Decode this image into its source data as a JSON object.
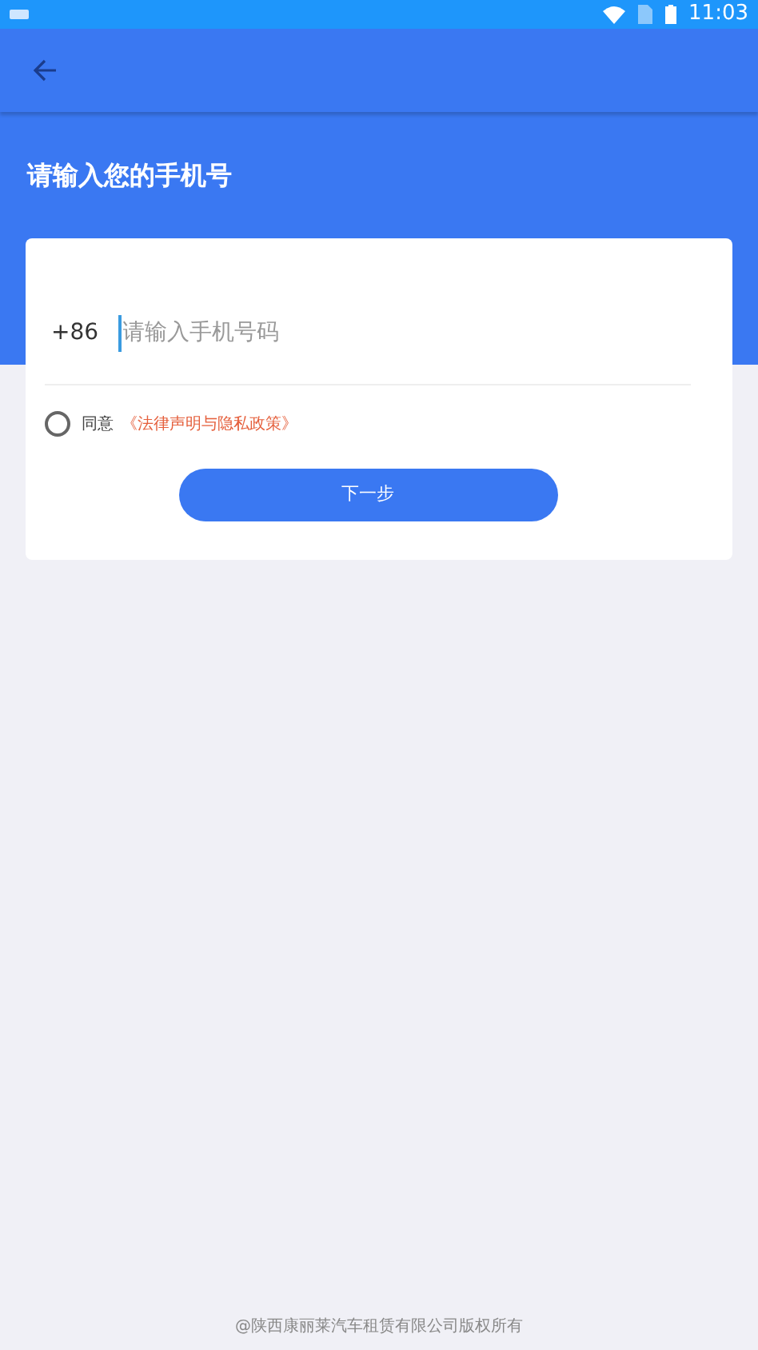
{
  "status_bar": {
    "time": "11:03"
  },
  "heading": "请输入您的手机号",
  "phone": {
    "country_code": "+86",
    "placeholder": "请输入手机号码"
  },
  "agreement": {
    "checked": false,
    "label": "同意",
    "link": "《法律声明与隐私政策》"
  },
  "next_button": "下一步",
  "footer": "@陕西康丽莱汽车租赁有限公司版权所有"
}
